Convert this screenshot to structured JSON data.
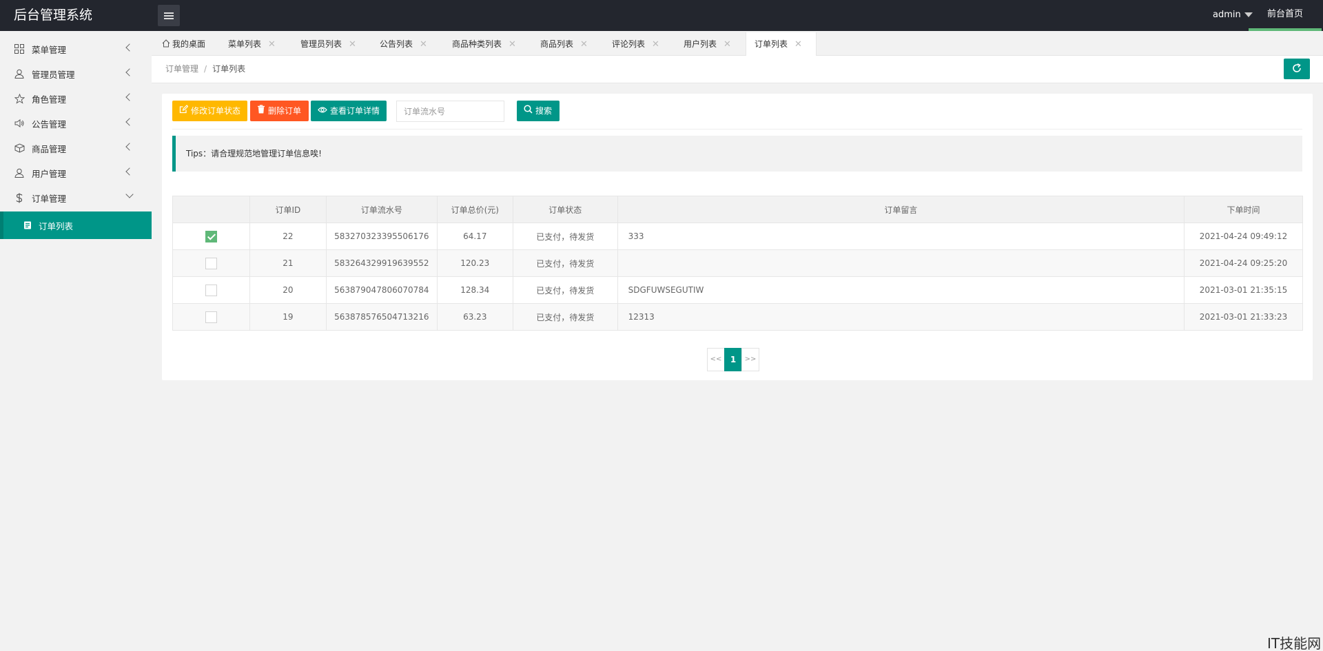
{
  "header": {
    "logo": "后台管理系统",
    "user": "admin",
    "front_home": "前台首页"
  },
  "sidebar": {
    "items": [
      {
        "label": "菜单管理",
        "icon": "grid-icon"
      },
      {
        "label": "管理员管理",
        "icon": "user-icon"
      },
      {
        "label": "角色管理",
        "icon": "star-icon"
      },
      {
        "label": "公告管理",
        "icon": "speaker-icon"
      },
      {
        "label": "商品管理",
        "icon": "box-icon"
      },
      {
        "label": "用户管理",
        "icon": "user-icon"
      },
      {
        "label": "订单管理",
        "icon": "dollar-icon"
      }
    ],
    "active_sub": "订单列表"
  },
  "tabs": [
    {
      "label": "我的桌面"
    },
    {
      "label": "菜单列表"
    },
    {
      "label": "管理员列表"
    },
    {
      "label": "公告列表"
    },
    {
      "label": "商品种类列表"
    },
    {
      "label": "商品列表"
    },
    {
      "label": "评论列表"
    },
    {
      "label": "用户列表"
    },
    {
      "label": "订单列表"
    }
  ],
  "breadcrumb": {
    "parent": "订单管理",
    "sep": "/",
    "current": "订单列表"
  },
  "toolbar": {
    "edit_status": "修改订单状态",
    "delete": "删除订单",
    "view_detail": "查看订单详情",
    "search_placeholder": "订单流水号",
    "search": "搜索"
  },
  "tips": "Tips：请合理规范地管理订单信息唉!",
  "table": {
    "columns": [
      "订单ID",
      "订单流水号",
      "订单总价(元)",
      "订单状态",
      "订单留言",
      "下单时间"
    ],
    "rows": [
      {
        "checked": true,
        "id": "22",
        "serial": "583270323395506176",
        "total": "64.17",
        "status": "已支付，待发货",
        "note": "333",
        "time": "2021-04-24 09:49:12"
      },
      {
        "checked": false,
        "id": "21",
        "serial": "583264329919639552",
        "total": "120.23",
        "status": "已支付，待发货",
        "note": "",
        "time": "2021-04-24 09:25:20"
      },
      {
        "checked": false,
        "id": "20",
        "serial": "563879047806070784",
        "total": "128.34",
        "status": "已支付，待发货",
        "note": "SDGFUWSEGUTIW",
        "time": "2021-03-01 21:35:15"
      },
      {
        "checked": false,
        "id": "19",
        "serial": "563878576504713216",
        "total": "63.23",
        "status": "已支付，待发货",
        "note": "12313",
        "time": "2021-03-01 21:33:23"
      }
    ]
  },
  "pager": {
    "prev": "<<",
    "current": "1",
    "next": ">>"
  },
  "watermark": "IT技能网",
  "colors": {
    "header_bg": "#23262e",
    "primary": "#009688",
    "warm": "#ffb800",
    "danger": "#ff5722",
    "checked": "#5fb878"
  }
}
